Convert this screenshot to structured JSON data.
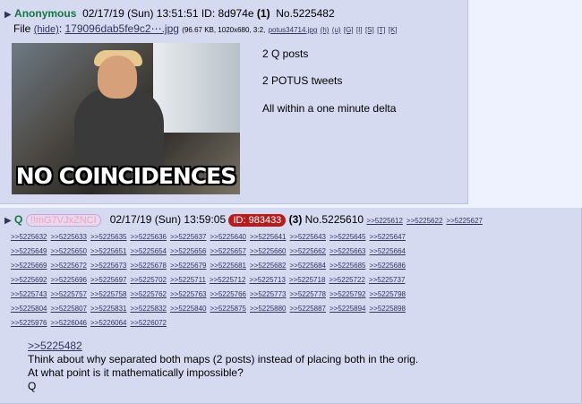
{
  "post1": {
    "name": "Anonymous",
    "datetime": "02/17/19 (Sun) 13:51:51",
    "id_label": "ID:",
    "id": "8d974e",
    "id_count": "(1)",
    "no": "No.5225482",
    "file_label": "File",
    "hide": "(hide)",
    "filename": "179096dab5fe9c2⋯.jpg",
    "filemeta": "(96.67 KB, 1020x680, 3:2,",
    "origname": "potus34714.jpg",
    "filelinks": [
      "(h)",
      "(u)",
      "[G]",
      "[I]",
      "[S]",
      "[T]",
      "[K]"
    ],
    "thumb_caption": "NO COINCIDENCES",
    "lines": [
      "2 Q posts",
      "2 POTUS tweets",
      "All within a one minute delta"
    ]
  },
  "post2": {
    "name": "Q",
    "trip": "!!mG7VJxZNCI",
    "datetime": "02/17/19 (Sun) 13:59:05",
    "id": "ID: 983433",
    "id_count": "(3)",
    "no": "No.5225610",
    "backlinks": [
      [
        ">>5225612",
        ">>5225622",
        ">>5225627"
      ],
      [
        ">>5225632",
        ">>5225633",
        ">>5225635",
        ">>5225636",
        ">>5225637",
        ">>5225640",
        ">>5225641",
        ">>5225643",
        ">>5225645",
        ">>5225647"
      ],
      [
        ">>5225649",
        ">>5225650",
        ">>5225651",
        ">>5225654",
        ">>5225656",
        ">>5225657",
        ">>5225660",
        ">>5225662",
        ">>5225663",
        ">>5225664"
      ],
      [
        ">>5225669",
        ">>5225672",
        ">>5225673",
        ">>5225678",
        ">>5225679",
        ">>5225681",
        ">>5225682",
        ">>5225684",
        ">>5225685",
        ">>5225686"
      ],
      [
        ">>5225692",
        ">>5225696",
        ">>5225697",
        ">>5225702",
        ">>5225711",
        ">>5225712",
        ">>5225713",
        ">>5225718",
        ">>5225722",
        ">>5225737"
      ],
      [
        ">>5225743",
        ">>5225757",
        ">>5225758",
        ">>5225762",
        ">>5225763",
        ">>5225766",
        ">>5225773",
        ">>5225778",
        ">>5225792",
        ">>5225798"
      ],
      [
        ">>5225804",
        ">>5225807",
        ">>5225831",
        ">>5225832",
        ">>5225840",
        ">>5225875",
        ">>5225880",
        ">>5225887",
        ">>5225894",
        ">>5225898"
      ],
      [
        ">>5225976",
        ">>5226046",
        ">>5226064",
        ">>5226072"
      ]
    ],
    "quote": ">>5225482",
    "lines": [
      "Think about why separated both maps (2 posts) instead of placing both in the orig.",
      "At what point is it mathematically impossible?",
      "Q"
    ]
  }
}
